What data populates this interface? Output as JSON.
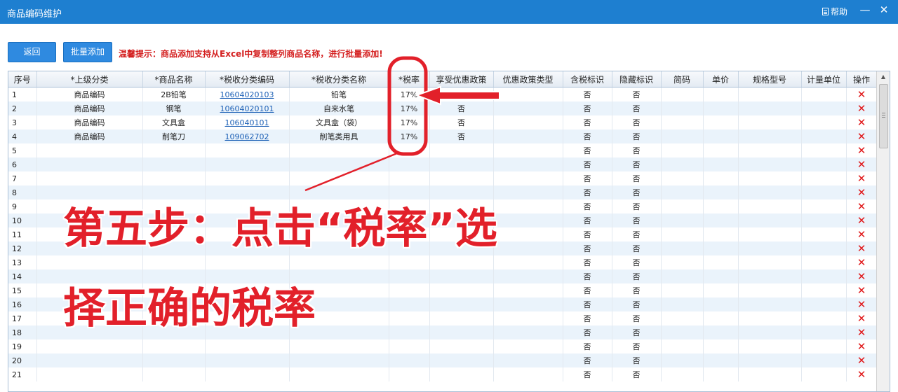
{
  "window": {
    "title": "商品编码维护",
    "help_label": "帮助",
    "minimize_glyph": "—",
    "close_glyph": "✕"
  },
  "toolbar": {
    "back_label": "返回",
    "batch_add_label": "批量添加",
    "hint": "温馨提示：商品添加支持从Excel中复制整列商品名称，进行批量添加!"
  },
  "table": {
    "columns": [
      "序号",
      "*上级分类",
      "*商品名称",
      "*税收分类编码",
      "*税收分类名称",
      "*税率",
      "享受优惠政策",
      "优惠政策类型",
      "含税标识",
      "隐藏标识",
      "简码",
      "单价",
      "规格型号",
      "计量单位",
      "操作"
    ],
    "rows": [
      {
        "seq": "1",
        "parent": "商品编码",
        "name": "2B铅笔",
        "tax_code": "10604020103",
        "tax_name": "铅笔",
        "rate": "17%",
        "pref": "否",
        "pref_type": "",
        "incl_tax": "否",
        "hidden": "否",
        "short": "",
        "price": "",
        "spec": "",
        "unit": "",
        "del": "✕"
      },
      {
        "seq": "2",
        "parent": "商品编码",
        "name": "钢笔",
        "tax_code": "10604020101",
        "tax_name": "自来水笔",
        "rate": "17%",
        "pref": "否",
        "pref_type": "",
        "incl_tax": "否",
        "hidden": "否",
        "short": "",
        "price": "",
        "spec": "",
        "unit": "",
        "del": "✕"
      },
      {
        "seq": "3",
        "parent": "商品编码",
        "name": "文具盒",
        "tax_code": "106040101",
        "tax_name": "文具盒（袋）",
        "rate": "17%",
        "pref": "否",
        "pref_type": "",
        "incl_tax": "否",
        "hidden": "否",
        "short": "",
        "price": "",
        "spec": "",
        "unit": "",
        "del": "✕"
      },
      {
        "seq": "4",
        "parent": "商品编码",
        "name": "削笔刀",
        "tax_code": "109062702",
        "tax_name": "削笔类用具",
        "rate": "17%",
        "pref": "否",
        "pref_type": "",
        "incl_tax": "否",
        "hidden": "否",
        "short": "",
        "price": "",
        "spec": "",
        "unit": "",
        "del": "✕"
      },
      {
        "seq": "5",
        "parent": "",
        "name": "",
        "tax_code": "",
        "tax_name": "",
        "rate": "",
        "pref": "",
        "pref_type": "",
        "incl_tax": "否",
        "hidden": "否",
        "short": "",
        "price": "",
        "spec": "",
        "unit": "",
        "del": "✕"
      },
      {
        "seq": "6",
        "parent": "",
        "name": "",
        "tax_code": "",
        "tax_name": "",
        "rate": "",
        "pref": "",
        "pref_type": "",
        "incl_tax": "否",
        "hidden": "否",
        "short": "",
        "price": "",
        "spec": "",
        "unit": "",
        "del": "✕"
      },
      {
        "seq": "7",
        "parent": "",
        "name": "",
        "tax_code": "",
        "tax_name": "",
        "rate": "",
        "pref": "",
        "pref_type": "",
        "incl_tax": "否",
        "hidden": "否",
        "short": "",
        "price": "",
        "spec": "",
        "unit": "",
        "del": "✕"
      },
      {
        "seq": "8",
        "parent": "",
        "name": "",
        "tax_code": "",
        "tax_name": "",
        "rate": "",
        "pref": "",
        "pref_type": "",
        "incl_tax": "否",
        "hidden": "否",
        "short": "",
        "price": "",
        "spec": "",
        "unit": "",
        "del": "✕"
      },
      {
        "seq": "9",
        "parent": "",
        "name": "",
        "tax_code": "",
        "tax_name": "",
        "rate": "",
        "pref": "",
        "pref_type": "",
        "incl_tax": "否",
        "hidden": "否",
        "short": "",
        "price": "",
        "spec": "",
        "unit": "",
        "del": "✕"
      },
      {
        "seq": "10",
        "parent": "",
        "name": "",
        "tax_code": "",
        "tax_name": "",
        "rate": "",
        "pref": "",
        "pref_type": "",
        "incl_tax": "否",
        "hidden": "否",
        "short": "",
        "price": "",
        "spec": "",
        "unit": "",
        "del": "✕"
      },
      {
        "seq": "11",
        "parent": "",
        "name": "",
        "tax_code": "",
        "tax_name": "",
        "rate": "",
        "pref": "",
        "pref_type": "",
        "incl_tax": "否",
        "hidden": "否",
        "short": "",
        "price": "",
        "spec": "",
        "unit": "",
        "del": "✕"
      },
      {
        "seq": "12",
        "parent": "",
        "name": "",
        "tax_code": "",
        "tax_name": "",
        "rate": "",
        "pref": "",
        "pref_type": "",
        "incl_tax": "否",
        "hidden": "否",
        "short": "",
        "price": "",
        "spec": "",
        "unit": "",
        "del": "✕"
      },
      {
        "seq": "13",
        "parent": "",
        "name": "",
        "tax_code": "",
        "tax_name": "",
        "rate": "",
        "pref": "",
        "pref_type": "",
        "incl_tax": "否",
        "hidden": "否",
        "short": "",
        "price": "",
        "spec": "",
        "unit": "",
        "del": "✕"
      },
      {
        "seq": "14",
        "parent": "",
        "name": "",
        "tax_code": "",
        "tax_name": "",
        "rate": "",
        "pref": "",
        "pref_type": "",
        "incl_tax": "否",
        "hidden": "否",
        "short": "",
        "price": "",
        "spec": "",
        "unit": "",
        "del": "✕"
      },
      {
        "seq": "15",
        "parent": "",
        "name": "",
        "tax_code": "",
        "tax_name": "",
        "rate": "",
        "pref": "",
        "pref_type": "",
        "incl_tax": "否",
        "hidden": "否",
        "short": "",
        "price": "",
        "spec": "",
        "unit": "",
        "del": "✕"
      },
      {
        "seq": "16",
        "parent": "",
        "name": "",
        "tax_code": "",
        "tax_name": "",
        "rate": "",
        "pref": "",
        "pref_type": "",
        "incl_tax": "否",
        "hidden": "否",
        "short": "",
        "price": "",
        "spec": "",
        "unit": "",
        "del": "✕"
      },
      {
        "seq": "17",
        "parent": "",
        "name": "",
        "tax_code": "",
        "tax_name": "",
        "rate": "",
        "pref": "",
        "pref_type": "",
        "incl_tax": "否",
        "hidden": "否",
        "short": "",
        "price": "",
        "spec": "",
        "unit": "",
        "del": "✕"
      },
      {
        "seq": "18",
        "parent": "",
        "name": "",
        "tax_code": "",
        "tax_name": "",
        "rate": "",
        "pref": "",
        "pref_type": "",
        "incl_tax": "否",
        "hidden": "否",
        "short": "",
        "price": "",
        "spec": "",
        "unit": "",
        "del": "✕"
      },
      {
        "seq": "19",
        "parent": "",
        "name": "",
        "tax_code": "",
        "tax_name": "",
        "rate": "",
        "pref": "",
        "pref_type": "",
        "incl_tax": "否",
        "hidden": "否",
        "short": "",
        "price": "",
        "spec": "",
        "unit": "",
        "del": "✕"
      },
      {
        "seq": "20",
        "parent": "",
        "name": "",
        "tax_code": "",
        "tax_name": "",
        "rate": "",
        "pref": "",
        "pref_type": "",
        "incl_tax": "否",
        "hidden": "否",
        "short": "",
        "price": "",
        "spec": "",
        "unit": "",
        "del": "✕"
      },
      {
        "seq": "21",
        "parent": "",
        "name": "",
        "tax_code": "",
        "tax_name": "",
        "rate": "",
        "pref": "",
        "pref_type": "",
        "incl_tax": "否",
        "hidden": "否",
        "short": "",
        "price": "",
        "spec": "",
        "unit": "",
        "del": "✕"
      }
    ]
  },
  "annotation": {
    "line1": "第五步：点击“税率”选",
    "line2": "择正确的税率",
    "color": "#e2202a"
  },
  "colors": {
    "titlebar": "#1e7fd0",
    "button": "#2f8ae0",
    "hint": "#d42020",
    "row_alt": "#eaf3fb",
    "delete": "#e0191b"
  }
}
